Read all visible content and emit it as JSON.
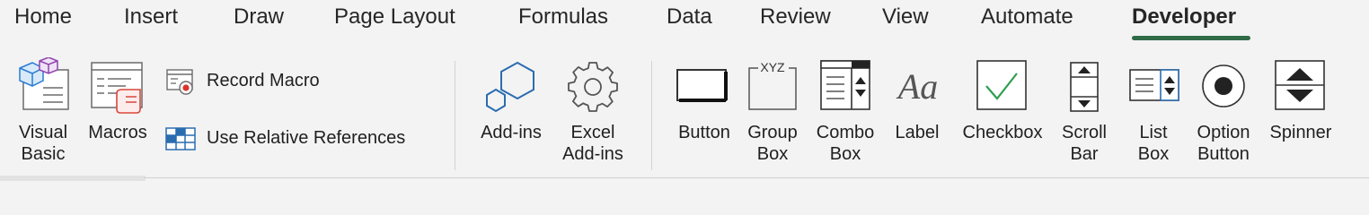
{
  "tabs": {
    "home": "Home",
    "insert": "Insert",
    "draw": "Draw",
    "page_layout": "Page Layout",
    "formulas": "Formulas",
    "data": "Data",
    "review": "Review",
    "view": "View",
    "automate": "Automate",
    "developer": "Developer"
  },
  "active_tab": "Developer",
  "accent_color": "#2f6b45",
  "ribbon": {
    "code": {
      "visual_basic_line1": "Visual",
      "visual_basic_line2": "Basic",
      "macros": "Macros",
      "record_macro": "Record Macro",
      "use_relative_references": "Use Relative References"
    },
    "addins": {
      "addins": "Add-ins",
      "excel_addins_line1": "Excel",
      "excel_addins_line2": "Add-ins"
    },
    "controls": {
      "button": "Button",
      "group_box_line1": "Group",
      "group_box_line2": "Box",
      "group_box_icon_text": "XYZ",
      "combo_box_line1": "Combo",
      "combo_box_line2": "Box",
      "label": "Label",
      "label_icon_text": "Aa",
      "checkbox": "Checkbox",
      "scroll_bar_line1": "Scroll",
      "scroll_bar_line2": "Bar",
      "list_box_line1": "List",
      "list_box_line2": "Box",
      "option_button_line1": "Option",
      "option_button_line2": "Button",
      "spinner": "Spinner"
    }
  }
}
